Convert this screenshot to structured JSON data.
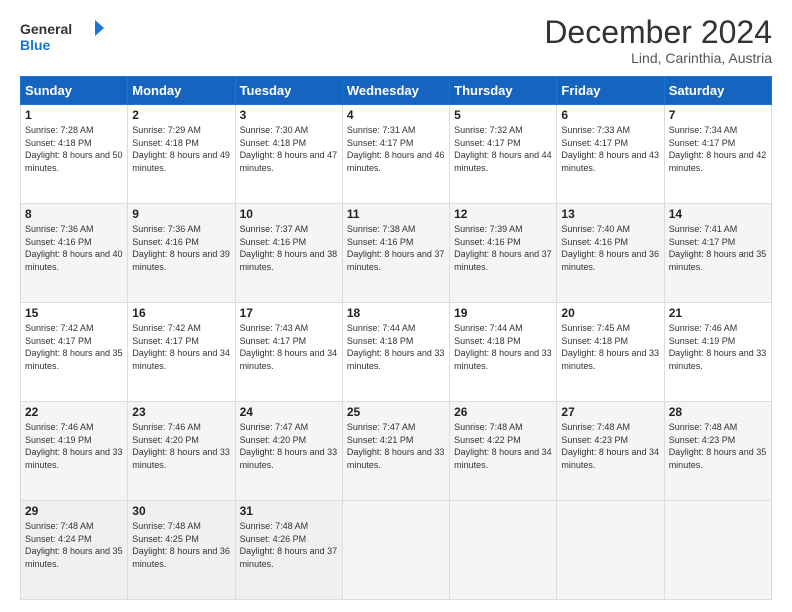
{
  "header": {
    "logo_line1": "General",
    "logo_line2": "Blue",
    "title": "December 2024",
    "subtitle": "Lind, Carinthia, Austria"
  },
  "calendar": {
    "days_of_week": [
      "Sunday",
      "Monday",
      "Tuesday",
      "Wednesday",
      "Thursday",
      "Friday",
      "Saturday"
    ],
    "weeks": [
      [
        {
          "day": "1",
          "sunrise": "7:28 AM",
          "sunset": "4:18 PM",
          "daylight": "8 hours and 50 minutes."
        },
        {
          "day": "2",
          "sunrise": "7:29 AM",
          "sunset": "4:18 PM",
          "daylight": "8 hours and 49 minutes."
        },
        {
          "day": "3",
          "sunrise": "7:30 AM",
          "sunset": "4:18 PM",
          "daylight": "8 hours and 47 minutes."
        },
        {
          "day": "4",
          "sunrise": "7:31 AM",
          "sunset": "4:17 PM",
          "daylight": "8 hours and 46 minutes."
        },
        {
          "day": "5",
          "sunrise": "7:32 AM",
          "sunset": "4:17 PM",
          "daylight": "8 hours and 44 minutes."
        },
        {
          "day": "6",
          "sunrise": "7:33 AM",
          "sunset": "4:17 PM",
          "daylight": "8 hours and 43 minutes."
        },
        {
          "day": "7",
          "sunrise": "7:34 AM",
          "sunset": "4:17 PM",
          "daylight": "8 hours and 42 minutes."
        }
      ],
      [
        {
          "day": "8",
          "sunrise": "7:36 AM",
          "sunset": "4:16 PM",
          "daylight": "8 hours and 40 minutes."
        },
        {
          "day": "9",
          "sunrise": "7:36 AM",
          "sunset": "4:16 PM",
          "daylight": "8 hours and 39 minutes."
        },
        {
          "day": "10",
          "sunrise": "7:37 AM",
          "sunset": "4:16 PM",
          "daylight": "8 hours and 38 minutes."
        },
        {
          "day": "11",
          "sunrise": "7:38 AM",
          "sunset": "4:16 PM",
          "daylight": "8 hours and 37 minutes."
        },
        {
          "day": "12",
          "sunrise": "7:39 AM",
          "sunset": "4:16 PM",
          "daylight": "8 hours and 37 minutes."
        },
        {
          "day": "13",
          "sunrise": "7:40 AM",
          "sunset": "4:16 PM",
          "daylight": "8 hours and 36 minutes."
        },
        {
          "day": "14",
          "sunrise": "7:41 AM",
          "sunset": "4:17 PM",
          "daylight": "8 hours and 35 minutes."
        }
      ],
      [
        {
          "day": "15",
          "sunrise": "7:42 AM",
          "sunset": "4:17 PM",
          "daylight": "8 hours and 35 minutes."
        },
        {
          "day": "16",
          "sunrise": "7:42 AM",
          "sunset": "4:17 PM",
          "daylight": "8 hours and 34 minutes."
        },
        {
          "day": "17",
          "sunrise": "7:43 AM",
          "sunset": "4:17 PM",
          "daylight": "8 hours and 34 minutes."
        },
        {
          "day": "18",
          "sunrise": "7:44 AM",
          "sunset": "4:18 PM",
          "daylight": "8 hours and 33 minutes."
        },
        {
          "day": "19",
          "sunrise": "7:44 AM",
          "sunset": "4:18 PM",
          "daylight": "8 hours and 33 minutes."
        },
        {
          "day": "20",
          "sunrise": "7:45 AM",
          "sunset": "4:18 PM",
          "daylight": "8 hours and 33 minutes."
        },
        {
          "day": "21",
          "sunrise": "7:46 AM",
          "sunset": "4:19 PM",
          "daylight": "8 hours and 33 minutes."
        }
      ],
      [
        {
          "day": "22",
          "sunrise": "7:46 AM",
          "sunset": "4:19 PM",
          "daylight": "8 hours and 33 minutes."
        },
        {
          "day": "23",
          "sunrise": "7:46 AM",
          "sunset": "4:20 PM",
          "daylight": "8 hours and 33 minutes."
        },
        {
          "day": "24",
          "sunrise": "7:47 AM",
          "sunset": "4:20 PM",
          "daylight": "8 hours and 33 minutes."
        },
        {
          "day": "25",
          "sunrise": "7:47 AM",
          "sunset": "4:21 PM",
          "daylight": "8 hours and 33 minutes."
        },
        {
          "day": "26",
          "sunrise": "7:48 AM",
          "sunset": "4:22 PM",
          "daylight": "8 hours and 34 minutes."
        },
        {
          "day": "27",
          "sunrise": "7:48 AM",
          "sunset": "4:23 PM",
          "daylight": "8 hours and 34 minutes."
        },
        {
          "day": "28",
          "sunrise": "7:48 AM",
          "sunset": "4:23 PM",
          "daylight": "8 hours and 35 minutes."
        }
      ],
      [
        {
          "day": "29",
          "sunrise": "7:48 AM",
          "sunset": "4:24 PM",
          "daylight": "8 hours and 35 minutes."
        },
        {
          "day": "30",
          "sunrise": "7:48 AM",
          "sunset": "4:25 PM",
          "daylight": "8 hours and 36 minutes."
        },
        {
          "day": "31",
          "sunrise": "7:48 AM",
          "sunset": "4:26 PM",
          "daylight": "8 hours and 37 minutes."
        },
        null,
        null,
        null,
        null
      ]
    ]
  }
}
